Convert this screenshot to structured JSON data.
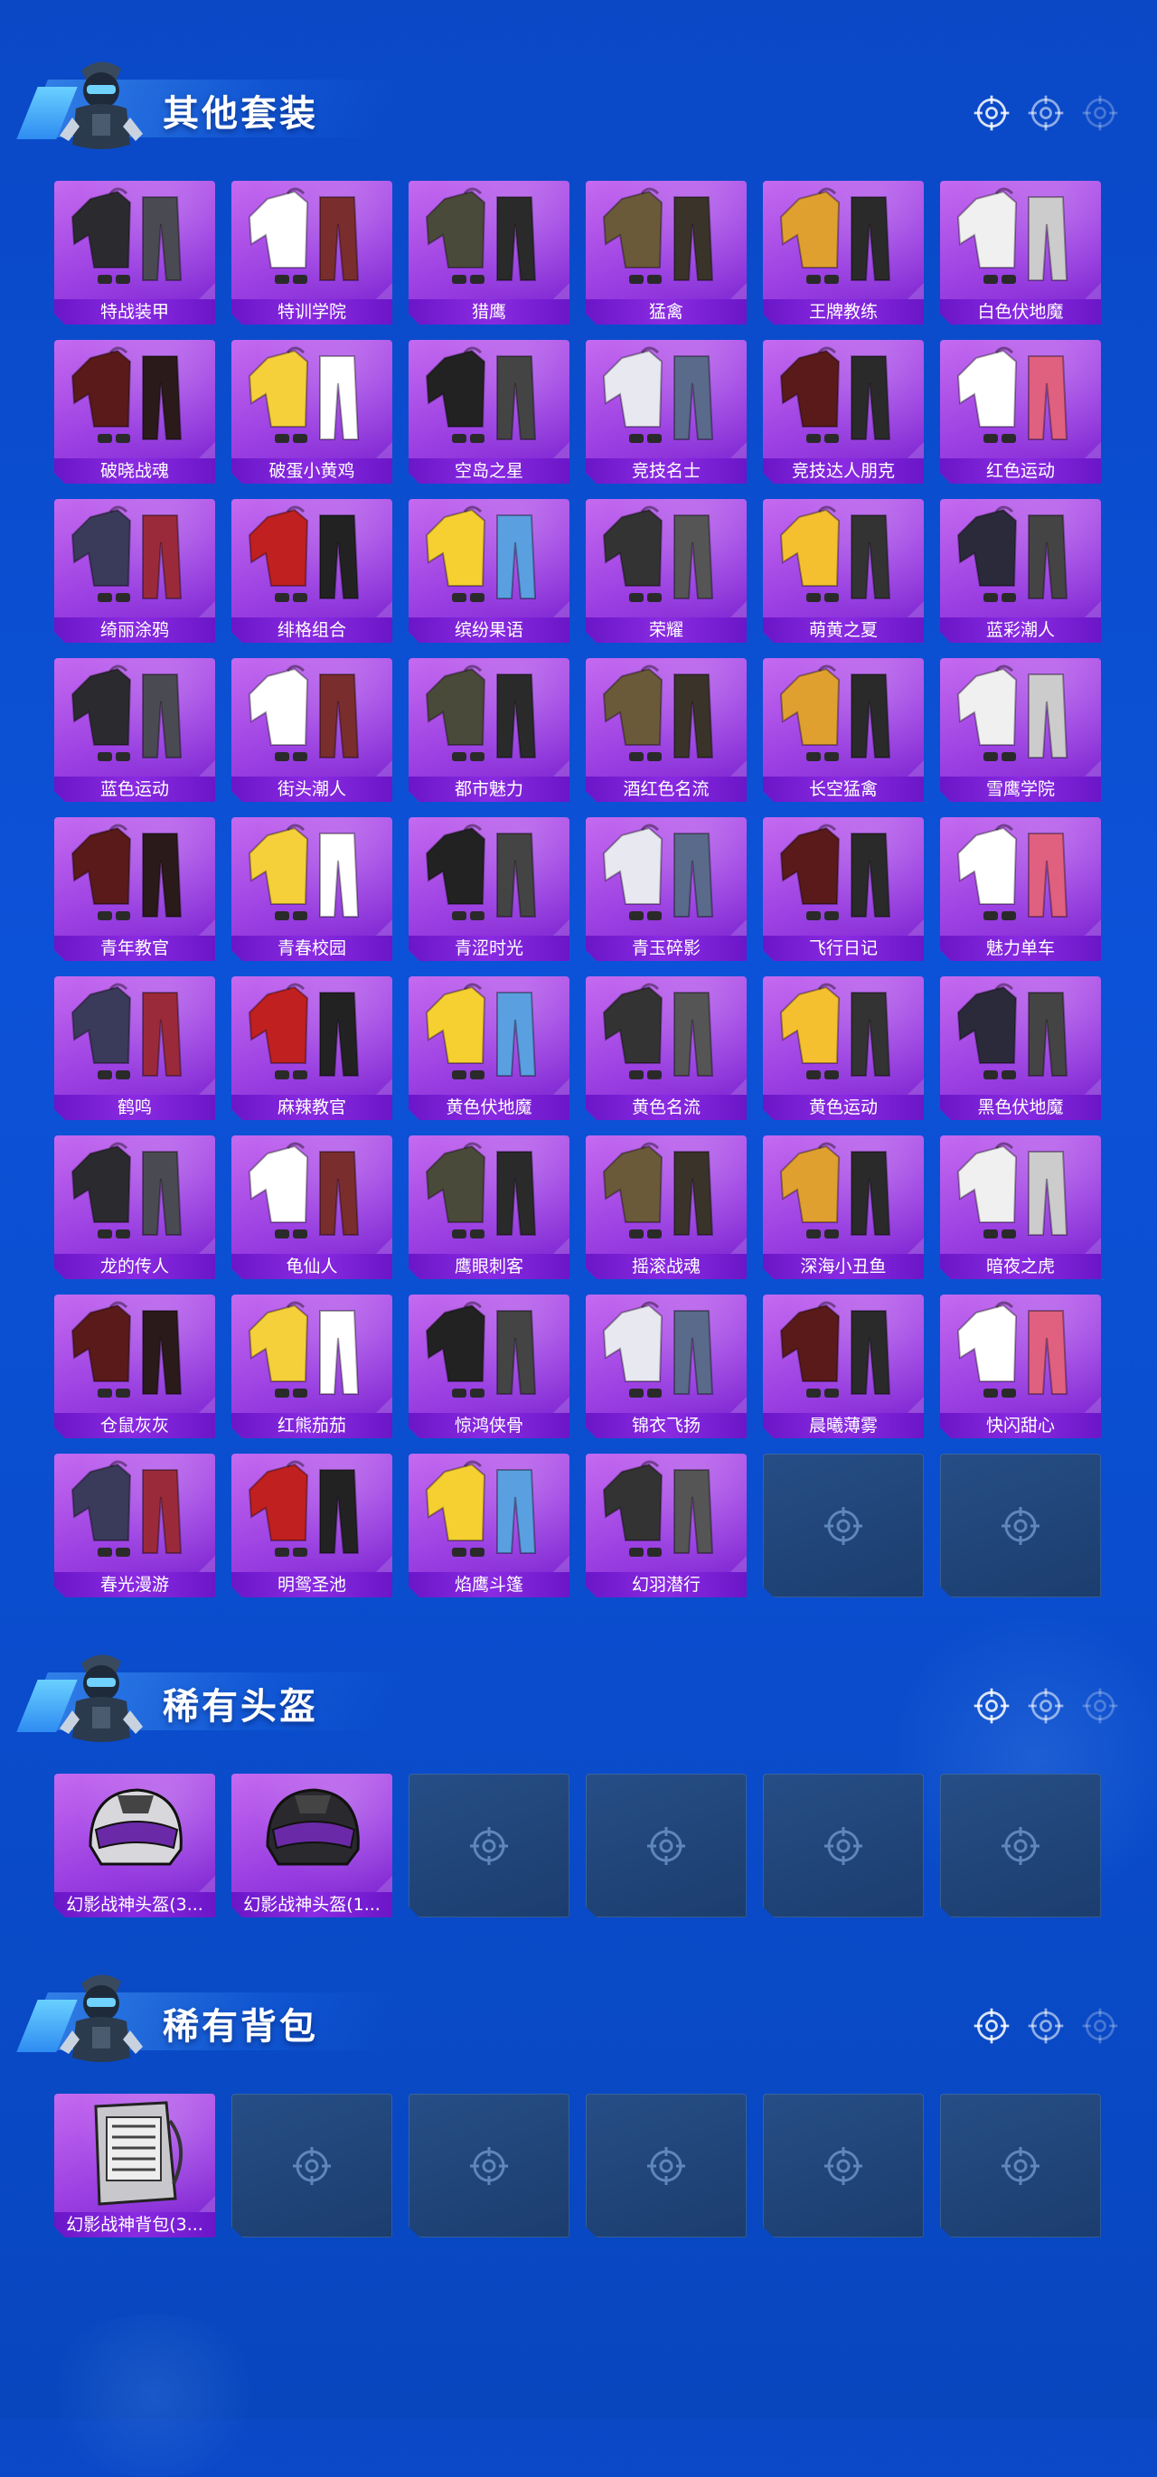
{
  "colors": {
    "background": "#0a48c6",
    "card_purple": "#9b3fe2",
    "label_purple": "#7a25cf",
    "empty_slot": "#1f4277",
    "title_text": "#ffffff"
  },
  "sections": [
    {
      "title": "其他套装",
      "icon": "mascot-icon",
      "items": [
        {
          "label": "特战装甲",
          "art": "outfit-icon"
        },
        {
          "label": "特训学院",
          "art": "outfit-icon"
        },
        {
          "label": "猎鹰",
          "art": "outfit-icon"
        },
        {
          "label": "猛禽",
          "art": "outfit-icon"
        },
        {
          "label": "王牌教练",
          "art": "outfit-icon"
        },
        {
          "label": "白色伏地魔",
          "art": "outfit-icon"
        },
        {
          "label": "破晓战魂",
          "art": "outfit-icon"
        },
        {
          "label": "破蛋小黄鸡",
          "art": "outfit-icon"
        },
        {
          "label": "空岛之星",
          "art": "outfit-icon"
        },
        {
          "label": "竞技名士",
          "art": "outfit-icon"
        },
        {
          "label": "竞技达人朋克",
          "art": "outfit-icon"
        },
        {
          "label": "红色运动",
          "art": "outfit-icon"
        },
        {
          "label": "绮丽涂鸦",
          "art": "outfit-icon"
        },
        {
          "label": "绯格组合",
          "art": "outfit-icon"
        },
        {
          "label": "缤纷果语",
          "art": "outfit-icon"
        },
        {
          "label": "荣耀",
          "art": "outfit-icon"
        },
        {
          "label": "萌黄之夏",
          "art": "outfit-icon"
        },
        {
          "label": "蓝彩潮人",
          "art": "outfit-icon"
        },
        {
          "label": "蓝色运动",
          "art": "outfit-icon"
        },
        {
          "label": "街头潮人",
          "art": "outfit-icon"
        },
        {
          "label": "都市魅力",
          "art": "outfit-icon"
        },
        {
          "label": "酒红色名流",
          "art": "outfit-icon"
        },
        {
          "label": "长空猛禽",
          "art": "outfit-icon"
        },
        {
          "label": "雪鹰学院",
          "art": "outfit-icon"
        },
        {
          "label": "青年教官",
          "art": "outfit-icon"
        },
        {
          "label": "青春校园",
          "art": "outfit-icon"
        },
        {
          "label": "青涩时光",
          "art": "outfit-icon"
        },
        {
          "label": "青玉碎影",
          "art": "outfit-icon"
        },
        {
          "label": "飞行日记",
          "art": "outfit-icon"
        },
        {
          "label": "魅力单车",
          "art": "outfit-icon"
        },
        {
          "label": "鹤鸣",
          "art": "outfit-icon"
        },
        {
          "label": "麻辣教官",
          "art": "outfit-icon"
        },
        {
          "label": "黄色伏地魔",
          "art": "outfit-icon"
        },
        {
          "label": "黄色名流",
          "art": "outfit-icon"
        },
        {
          "label": "黄色运动",
          "art": "outfit-icon"
        },
        {
          "label": "黑色伏地魔",
          "art": "outfit-icon"
        },
        {
          "label": "龙的传人",
          "art": "outfit-icon"
        },
        {
          "label": "龟仙人",
          "art": "outfit-icon"
        },
        {
          "label": "鹰眼刺客",
          "art": "outfit-icon"
        },
        {
          "label": "摇滚战魂",
          "art": "outfit-icon"
        },
        {
          "label": "深海小丑鱼",
          "art": "outfit-icon"
        },
        {
          "label": "暗夜之虎",
          "art": "outfit-icon"
        },
        {
          "label": "仓鼠灰灰",
          "art": "outfit-icon"
        },
        {
          "label": "红熊茄茄",
          "art": "outfit-icon"
        },
        {
          "label": "惊鸿侠骨",
          "art": "outfit-icon"
        },
        {
          "label": "锦衣飞扬",
          "art": "outfit-icon"
        },
        {
          "label": "晨曦薄雾",
          "art": "outfit-icon"
        },
        {
          "label": "快闪甜心",
          "art": "outfit-icon"
        },
        {
          "label": "春光漫游",
          "art": "outfit-icon"
        },
        {
          "label": "明鸳圣池",
          "art": "outfit-icon"
        },
        {
          "label": "焰鹰斗篷",
          "art": "outfit-icon"
        },
        {
          "label": "幻羽潜行",
          "art": "outfit-icon"
        }
      ],
      "empty_slots": 2
    },
    {
      "title": "稀有头盔",
      "icon": "mascot-icon",
      "items": [
        {
          "label": "幻影战神头盔(3...",
          "art": "helmet-icon"
        },
        {
          "label": "幻影战神头盔(1...",
          "art": "helmet-icon"
        }
      ],
      "empty_slots": 4
    },
    {
      "title": "稀有背包",
      "icon": "mascot-icon",
      "items": [
        {
          "label": "幻影战神背包(3...",
          "art": "backpack-icon"
        }
      ],
      "empty_slots": 5
    }
  ],
  "empty_slot_icon": "crosshair-icon",
  "header_deco_icon": "crosshair-icon"
}
